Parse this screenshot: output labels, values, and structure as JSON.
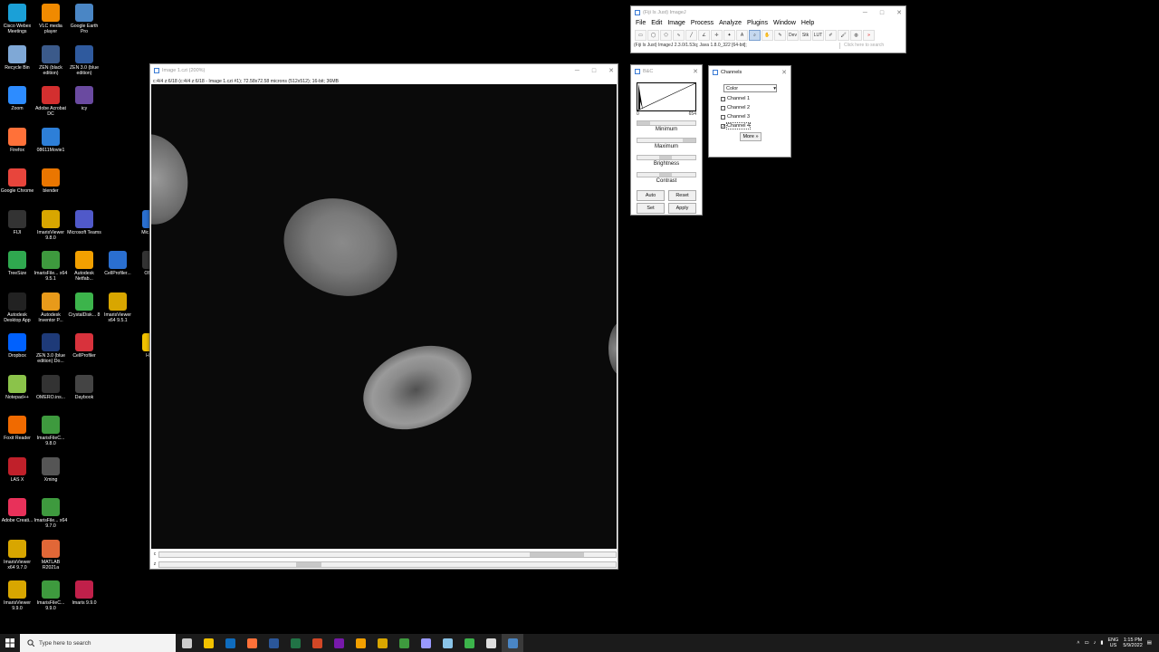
{
  "desktop_icons": [
    {
      "label": "Cisco Webex Meetings",
      "color": "#1ba0d7",
      "icon": "webex-icon"
    },
    {
      "label": "VLC media player",
      "color": "#f08a00",
      "icon": "vlc-icon"
    },
    {
      "label": "Google Earth Pro",
      "color": "#4a86c5",
      "icon": "google-earth-icon"
    },
    {
      "label": "Recycle Bin",
      "color": "#7fa8d6",
      "icon": "recycle-bin-icon"
    },
    {
      "label": "ZEN (black edition)",
      "color": "#3b5a8a",
      "icon": "zen-icon"
    },
    {
      "label": "ZEN 3.0 (blue edition)",
      "color": "#2f5a9e",
      "icon": "zen-icon"
    },
    {
      "label": "Zoom",
      "color": "#2d8cff",
      "icon": "zoom-icon"
    },
    {
      "label": "Adobe Acrobat DC",
      "color": "#d32f2f",
      "icon": "acrobat-icon"
    },
    {
      "label": "icy",
      "color": "#6a4aa0",
      "icon": "icy-icon"
    },
    {
      "label": "Firefox",
      "color": "#ff7139",
      "icon": "firefox-icon"
    },
    {
      "label": "08611Movie1",
      "color": "#2d7fd8",
      "icon": "movie-file-icon"
    },
    {
      "label": "Google Chrome",
      "color": "#e8453c",
      "icon": "chrome-icon"
    },
    {
      "label": "blender",
      "color": "#ea7600",
      "icon": "blender-icon"
    },
    {
      "label": "FIJI",
      "color": "#333333",
      "icon": "fiji-icon"
    },
    {
      "label": "ImarisViewer 9.8.0",
      "color": "#d8a600",
      "icon": "imaris-viewer-icon"
    },
    {
      "label": "Microsoft Teams",
      "color": "#5059c9",
      "icon": "teams-icon"
    },
    {
      "label": "TreeSize",
      "color": "#2fa84f",
      "icon": "treesize-icon"
    },
    {
      "label": "ImarisFile... x64 9.5.1",
      "color": "#3e9a3e",
      "icon": "imaris-file-icon"
    },
    {
      "label": "Autodesk Netfab...",
      "color": "#f2a000",
      "icon": "netfabb-icon"
    },
    {
      "label": "CellProfiler...",
      "color": "#2a6fd0",
      "icon": "cellprofiler-icon"
    },
    {
      "label": "Autodesk Desktop App",
      "color": "#222222",
      "icon": "autodesk-icon"
    },
    {
      "label": "Autodesk Inventor P...",
      "color": "#e89a1a",
      "icon": "inventor-icon"
    },
    {
      "label": "CrystalDisk... 8",
      "color": "#3cb44b",
      "icon": "crystaldisk-icon"
    },
    {
      "label": "ImarisViewer x64 9.5.1",
      "color": "#d8a600",
      "icon": "imaris-viewer-icon"
    },
    {
      "label": "Dropbox",
      "color": "#0061fe",
      "icon": "dropbox-icon"
    },
    {
      "label": "ZEN 3.0 (blue edition) Do...",
      "color": "#1e3a78",
      "icon": "zeiss-icon"
    },
    {
      "label": "CellProfiler",
      "color": "#d8323c",
      "icon": "cellprofiler-icon"
    },
    {
      "label": "Notepad++",
      "color": "#8bc34a",
      "icon": "notepadpp-icon"
    },
    {
      "label": "OMERO.ins...",
      "color": "#333333",
      "icon": "omero-icon"
    },
    {
      "label": "Daybook",
      "color": "#444444",
      "icon": "daybook-icon"
    },
    {
      "label": "Foxit Reader",
      "color": "#f06a00",
      "icon": "foxit-icon"
    },
    {
      "label": "ImarisFileC... 9.8.0",
      "color": "#3e9a3e",
      "icon": "imaris-file-icon"
    },
    {
      "label": "LAS X",
      "color": "#c0202a",
      "icon": "lasx-icon"
    },
    {
      "label": "Xming",
      "color": "#555555",
      "icon": "xming-icon"
    },
    {
      "label": "Adobe Creati...",
      "color": "#e8315a",
      "icon": "creative-cloud-icon"
    },
    {
      "label": "ImarisFile... x64 9.7.0",
      "color": "#3e9a3e",
      "icon": "imaris-file-icon"
    },
    {
      "label": "ImarisViewer x64 9.7.0",
      "color": "#d8a600",
      "icon": "imaris-viewer-icon"
    },
    {
      "label": "MATLAB R2021a",
      "color": "#e16737",
      "icon": "matlab-icon"
    },
    {
      "label": "ImarisViewer 9.9.0",
      "color": "#d8a600",
      "icon": "imaris-viewer-icon"
    },
    {
      "label": "ImarisFileC... 9.9.0",
      "color": "#3e9a3e",
      "icon": "imaris-file-icon"
    },
    {
      "label": "Imaris 9.9.0",
      "color": "#c0204a",
      "icon": "imaris-icon"
    },
    {
      "label": "Mic... E...",
      "color": "#2a6fd0",
      "icon": "partial-icon"
    },
    {
      "label": "OBS...",
      "color": "#333333",
      "icon": "obs-icon"
    },
    {
      "label": "HC...",
      "color": "#f2c200",
      "icon": "folder-icon"
    }
  ],
  "image_window": {
    "title": "Image 1.czi (200%)",
    "info": "c:4/4 z:6/18 (c:4/4 z:6/18 - Image 1.czi #1); 72.58x72.58 microns (512x512); 16-bit; 36MB",
    "c_label": "c",
    "z_label": "z",
    "c_position": 0.93,
    "z_position": 0.3
  },
  "imagej": {
    "title": "(Fiji Is Just) ImageJ",
    "menus": [
      "File",
      "Edit",
      "Image",
      "Process",
      "Analyze",
      "Plugins",
      "Window",
      "Help"
    ],
    "tools": [
      "rectangle-tool",
      "oval-tool",
      "polygon-tool",
      "freehand-tool",
      "line-tool",
      "angle-tool",
      "point-tool",
      "wand-tool",
      "text-tool",
      "zoom-tool",
      "hand-tool",
      "dropper-tool",
      "Dev",
      "Stk",
      "LUT",
      "pen-tool",
      "brush-tool",
      "flood-fill-tool",
      "more-tools"
    ],
    "tool_text": {
      "dev": "Dev",
      "stk": "Stk",
      "lut": "LUT"
    },
    "status": "(Fiji Is Just) ImageJ 2.3.0/1.53q; Java 1.8.0_322 [64-bit];",
    "search_placeholder": "Click here to search"
  },
  "bc": {
    "title": "B&C",
    "hist_min": "0",
    "hist_max": "654",
    "minimum_label": "Minimum",
    "maximum_label": "Maximum",
    "brightness_label": "Brightness",
    "contrast_label": "Contrast",
    "auto": "Auto",
    "reset": "Reset",
    "set": "Set",
    "apply": "Apply"
  },
  "channels": {
    "title": "Channels",
    "mode": "Color",
    "items": [
      {
        "label": "Channel 1",
        "checked": false
      },
      {
        "label": "Channel 2",
        "checked": false
      },
      {
        "label": "Channel 3",
        "checked": false
      },
      {
        "label": "Channel 4",
        "checked": true
      }
    ],
    "more": "More »"
  },
  "taskbar": {
    "search_placeholder": "Type here to search",
    "apps": [
      {
        "icon": "task-view-icon",
        "color": "#cccccc"
      },
      {
        "icon": "file-explorer-icon",
        "color": "#f2c200"
      },
      {
        "icon": "outlook-icon",
        "color": "#0f6cbd"
      },
      {
        "icon": "firefox-icon",
        "color": "#ff7139"
      },
      {
        "icon": "word-icon",
        "color": "#2b579a"
      },
      {
        "icon": "excel-icon",
        "color": "#217346"
      },
      {
        "icon": "powerpoint-icon",
        "color": "#d24726"
      },
      {
        "icon": "onenote-icon",
        "color": "#7719aa"
      },
      {
        "icon": "sticky-app-icon",
        "color": "#f2a000"
      },
      {
        "icon": "imaris-viewer-icon",
        "color": "#d8a600"
      },
      {
        "icon": "imaris-file-icon",
        "color": "#3e9a3e"
      },
      {
        "icon": "premiere-icon",
        "color": "#9999ff"
      },
      {
        "icon": "snip-icon",
        "color": "#8ac4e8"
      },
      {
        "icon": "green-app-icon",
        "color": "#3cb44b"
      },
      {
        "icon": "clock-app-icon",
        "color": "#dddddd"
      },
      {
        "icon": "fiji-taskbar-icon",
        "color": "#4a86c5"
      }
    ],
    "lang": "ENG",
    "region": "US",
    "time": "1:15 PM",
    "date": "5/9/2022"
  }
}
